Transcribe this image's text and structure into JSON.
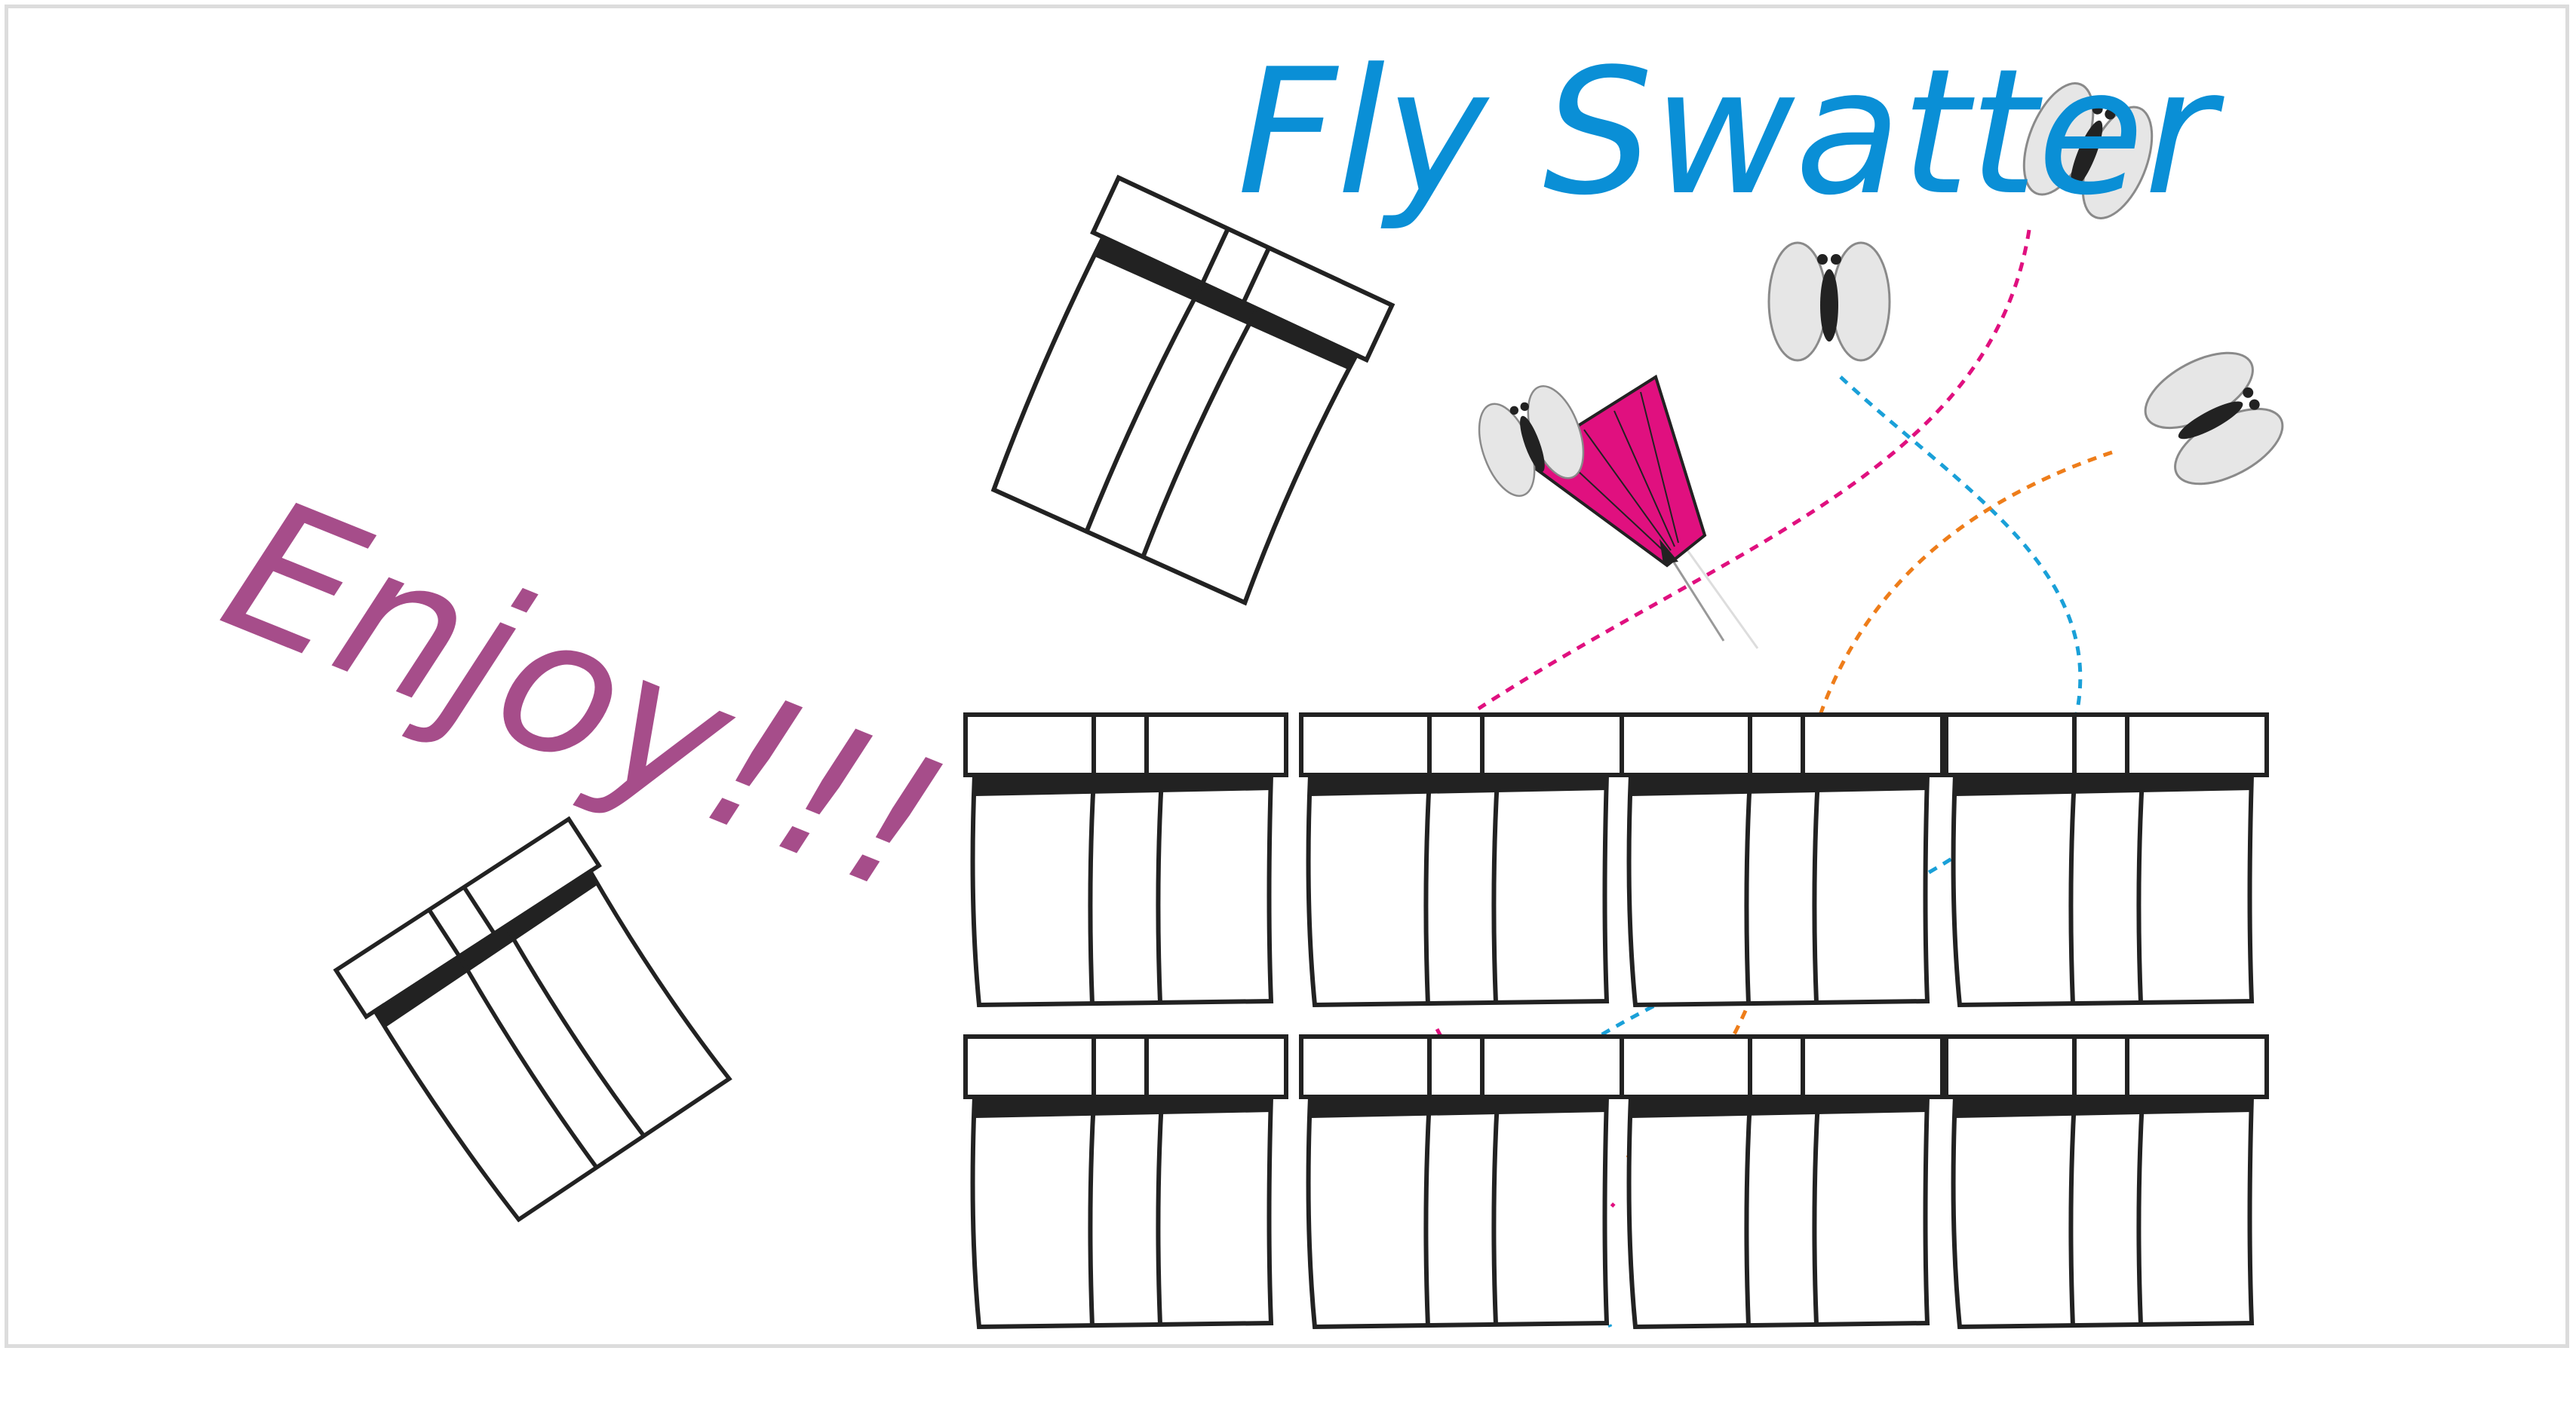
{
  "title": {
    "text": "Fly Swatter",
    "color": "#0a8fd6"
  },
  "enjoy": {
    "text": "Enjoy!!!",
    "color": "#a64d8a"
  },
  "colors": {
    "outline": "#222222",
    "box_fill": "#ffffff",
    "swatter": "#e0107f",
    "fly_wing": "#e6e6e6",
    "fly_body": "#222222",
    "trail_pink": "#e0107f",
    "trail_blue": "#1aa0d8",
    "trail_orange": "#ee7d1a",
    "frame": "#dcdcdc"
  },
  "icons": {
    "swatter": "fly-swatter-icon",
    "fly": "fly-icon",
    "gift": "gift-box-icon"
  },
  "grid": {
    "rows": 2,
    "columns": 4
  },
  "flies_count": 3,
  "flying_gifts_count": 2
}
